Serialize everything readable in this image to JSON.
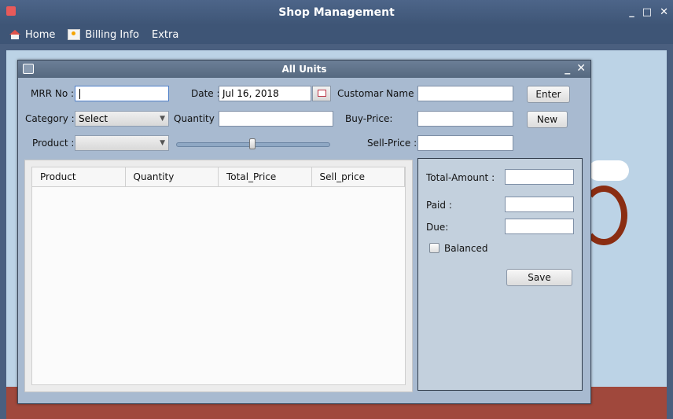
{
  "window": {
    "title": "Shop Management",
    "controls": [
      "_",
      "□",
      "✕"
    ]
  },
  "menu": [
    {
      "label": "Home",
      "icon": "home-icon"
    },
    {
      "label": "Billing Info",
      "icon": "billing-icon"
    },
    {
      "label": "Extra",
      "icon": ""
    }
  ],
  "frame": {
    "title": "All Units",
    "controls": [
      "_",
      "✕"
    ]
  },
  "form": {
    "mrr_label": "MRR No :",
    "mrr_value": "",
    "date_label": "Date :",
    "date_value": "Jul 16, 2018",
    "customer_label": "Customar Name :",
    "customer_value": "",
    "enter_button": "Enter",
    "category_label": "Category ::",
    "category_value": "Select",
    "quantity_label": "Quantity :",
    "quantity_value": "",
    "buy_price_label": "Buy-Price:",
    "buy_price_value": "",
    "new_button": "New",
    "product_label": "Product :",
    "product_value": "",
    "sell_price_label": "Sell-Price :",
    "sell_price_value": "",
    "slider_fraction": 0.5
  },
  "table": {
    "columns": [
      "Product",
      "Quantity",
      "Total_Price",
      "Sell_price"
    ],
    "rows": []
  },
  "summary": {
    "total_label": "Total-Amount :",
    "total_value": "",
    "paid_label": "Paid :",
    "paid_value": "",
    "due_label": "Due:",
    "due_value": "",
    "balanced_label": "Balanced",
    "balanced_checked": false,
    "save_button": "Save"
  },
  "colors": {
    "titlebar": "#4d6589",
    "frame_bg": "#a8bad0",
    "panel_bg": "#c3d0dd"
  }
}
